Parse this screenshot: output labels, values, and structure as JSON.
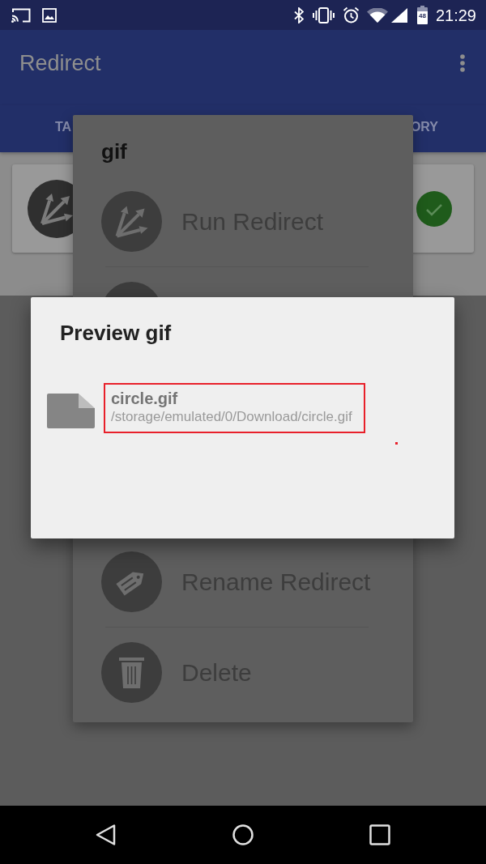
{
  "status_bar": {
    "battery_text": "48",
    "time": "21:29"
  },
  "app_bar": {
    "title": "Redirect"
  },
  "tabs": [
    {
      "label": "TA"
    },
    {
      "label": "ORY"
    }
  ],
  "redirect_card": {
    "enabled": true
  },
  "menu_dialog": {
    "title": "gif",
    "items": [
      {
        "label": "Run Redirect",
        "kind": "run"
      },
      {
        "label": "Rename Redirect",
        "kind": "rename"
      },
      {
        "label": "Delete",
        "kind": "delete"
      }
    ]
  },
  "preview_dialog": {
    "title": "Preview gif",
    "files": [
      {
        "name": "circle.gif",
        "path": "/storage/emulated/0/Download/circle.gif",
        "highlighted": true
      }
    ]
  }
}
